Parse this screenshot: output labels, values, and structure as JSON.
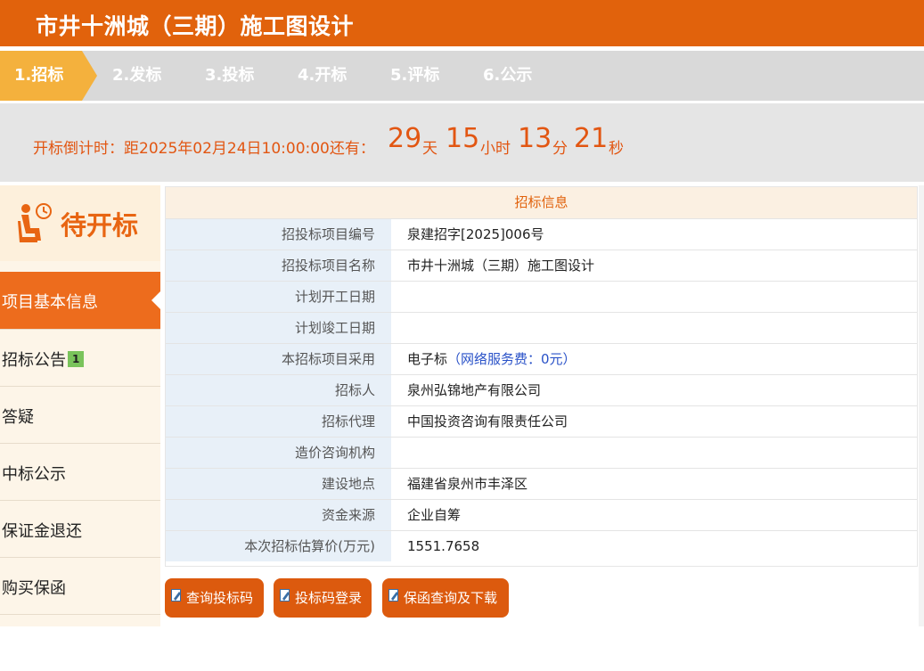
{
  "header": {
    "title": "市井十洲城（三期）施工图设计"
  },
  "steps": [
    {
      "label": "1.招标",
      "active": true
    },
    {
      "label": "2.发标"
    },
    {
      "label": "3.投标"
    },
    {
      "label": "4.开标"
    },
    {
      "label": "5.评标"
    },
    {
      "label": "6.公示"
    }
  ],
  "countdown": {
    "prefix": "开标倒计时：距2025年02月24日10:00:00还有：",
    "days": "29",
    "days_unit": "天",
    "hours": "15",
    "hours_unit": "小时",
    "minutes": "13",
    "minutes_unit": "分",
    "seconds": "21",
    "seconds_unit": "秒"
  },
  "sidebar": {
    "status": "待开标",
    "items": [
      {
        "label": "项目基本信息",
        "active": true
      },
      {
        "label": "招标公告",
        "badge": "1"
      },
      {
        "label": "答疑"
      },
      {
        "label": "中标公示"
      },
      {
        "label": "保证金退还"
      },
      {
        "label": "购买保函"
      }
    ]
  },
  "info": {
    "title": "招标信息",
    "rows": [
      {
        "key": "招投标项目编号",
        "value": "泉建招字[2025]006号"
      },
      {
        "key": "招投标项目名称",
        "value": "市井十洲城（三期）施工图设计"
      },
      {
        "key": "计划开工日期",
        "value": ""
      },
      {
        "key": "计划竣工日期",
        "value": ""
      },
      {
        "key": "本招标项目采用",
        "value": "电子标",
        "note": "（网络服务费：0元）"
      },
      {
        "key": "招标人",
        "value": "泉州弘锦地产有限公司"
      },
      {
        "key": "招标代理",
        "value": "中国投资咨询有限责任公司"
      },
      {
        "key": "造价咨询机构",
        "value": ""
      },
      {
        "key": "建设地点",
        "value": "福建省泉州市丰泽区"
      },
      {
        "key": "资金来源",
        "value": "企业自筹"
      },
      {
        "key": "本次招标估算价(万元)",
        "value": "1551.7658"
      }
    ]
  },
  "buttons": {
    "query_code": "查询投标码",
    "code_login": "投标码登录",
    "guarantee": "保函查询及下载"
  },
  "colors": {
    "brand": "#e1620c",
    "accent": "#f4b13d",
    "link": "#2a52c8"
  }
}
